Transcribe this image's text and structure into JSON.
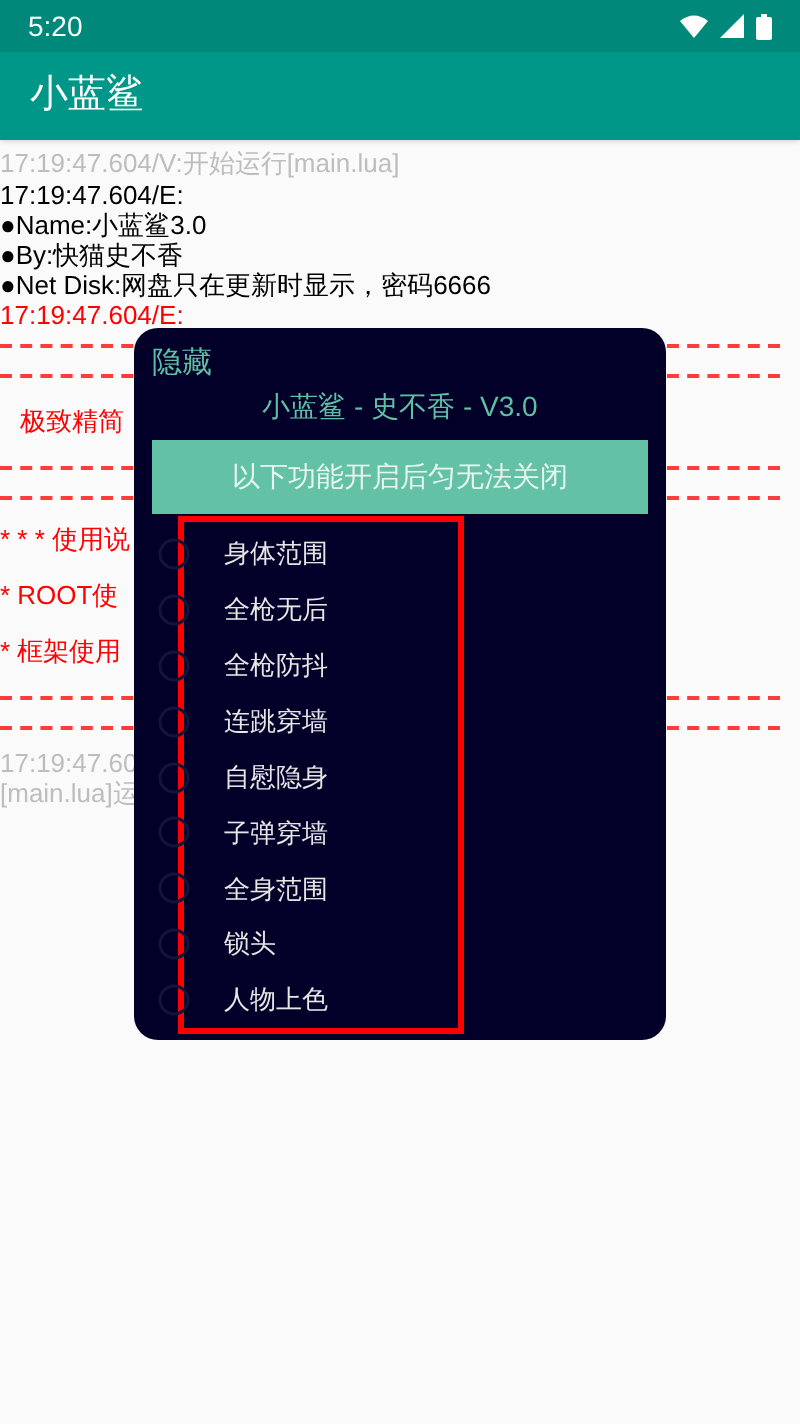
{
  "status_bar": {
    "time": "5:20"
  },
  "app_bar": {
    "title": "小蓝鲨"
  },
  "log": [
    {
      "kind": "text",
      "color": "#bdbdbd",
      "text": "17:19:47.604/V:开始运行[main.lua]"
    },
    {
      "kind": "text",
      "color": "#000000",
      "text": "17:19:47.604/E:"
    },
    {
      "kind": "text",
      "color": "#000000",
      "text": "●Name:小蓝鲨3.0"
    },
    {
      "kind": "text",
      "color": "#000000",
      "text": "●By:快猫史不香"
    },
    {
      "kind": "text",
      "color": "#000000",
      "text": "●Net Disk:网盘只在更新时显示，密码6666"
    },
    {
      "kind": "text",
      "color": "#ff0000",
      "text": "17:19:47.604/E:"
    },
    {
      "kind": "dash"
    },
    {
      "kind": "dash"
    },
    {
      "kind": "text",
      "color": "#ff0000",
      "text": "极致精简"
    },
    {
      "kind": "dash"
    },
    {
      "kind": "dash"
    },
    {
      "kind": "text",
      "color": "#ff0000",
      "text": "* * * 使用说"
    },
    {
      "kind": "text",
      "color": "#ff0000",
      "text": "* ROOT使"
    },
    {
      "kind": "text",
      "color": "#ff0000",
      "text": "* 框架使用"
    },
    {
      "kind": "dash"
    },
    {
      "kind": "dash"
    },
    {
      "kind": "text",
      "color": "#bdbdbd",
      "text": "17:19:47.60"
    },
    {
      "kind": "text",
      "color": "#bdbdbd",
      "text": "[main.lua]运"
    }
  ],
  "dialog": {
    "hide_label": "隐藏",
    "title": "小蓝鲨 - 史不香 - V3.0",
    "notice": "以下功能开启后匀无法关闭",
    "options": [
      {
        "label": "身体范围",
        "checked": false
      },
      {
        "label": "全枪无后",
        "checked": false
      },
      {
        "label": "全枪防抖",
        "checked": false
      },
      {
        "label": "连跳穿墙",
        "checked": false
      },
      {
        "label": "自慰隐身",
        "checked": false
      },
      {
        "label": "子弹穿墙",
        "checked": false
      },
      {
        "label": "全身范围",
        "checked": false
      },
      {
        "label": "锁头",
        "checked": false
      },
      {
        "label": "人物上色",
        "checked": false
      }
    ]
  }
}
